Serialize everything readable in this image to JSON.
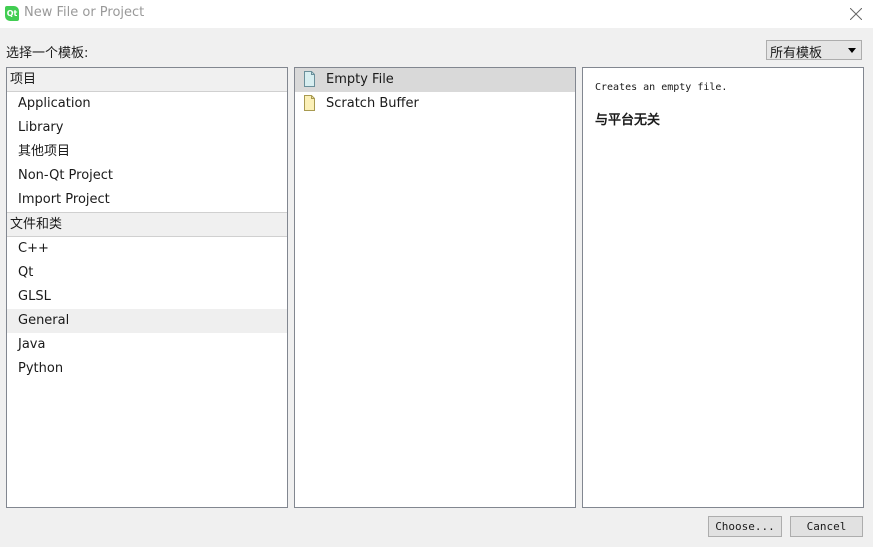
{
  "window": {
    "title": "New File or Project"
  },
  "toolbar": {
    "choose_label": "选择一个模板:",
    "filter": {
      "selected": "所有模板"
    }
  },
  "categories": {
    "project_header": "项目",
    "project_items": [
      "Application",
      "Library",
      "其他项目",
      "Non-Qt Project",
      "Import Project"
    ],
    "files_header": "文件和类",
    "files_items": [
      "C++",
      "Qt",
      "GLSL",
      "General",
      "Java",
      "Python"
    ],
    "selected": "General"
  },
  "templates": {
    "items": [
      "Empty File",
      "Scratch Buffer"
    ],
    "selected": "Empty File"
  },
  "description": {
    "text": "Creates an empty file.",
    "platform": "与平台无关"
  },
  "buttons": {
    "choose": "Choose...",
    "cancel": "Cancel"
  },
  "colors": {
    "qt_green": "#41cd52",
    "selected_template": "#d9d9d9",
    "selected_category": "#efefef"
  }
}
